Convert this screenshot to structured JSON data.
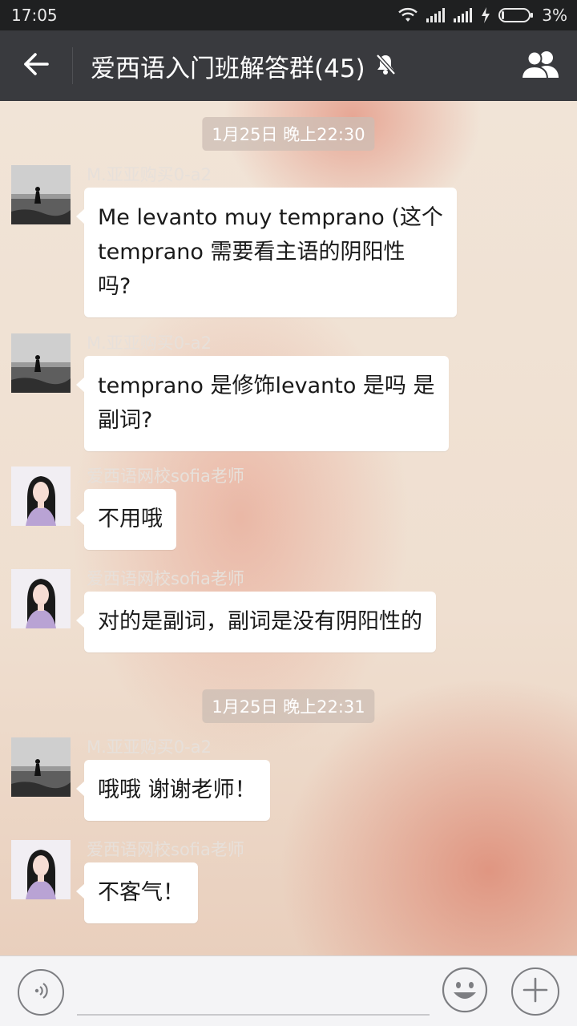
{
  "status_bar": {
    "time": "17:05",
    "battery_percent": "3%",
    "icons": [
      "wifi-icon",
      "signal-icon",
      "signal-icon",
      "charging-icon",
      "battery-icon"
    ]
  },
  "header": {
    "title": "爱西语入门班解答群(45)",
    "icons": [
      "back-arrow-icon",
      "mute-bell-icon",
      "group-members-icon"
    ]
  },
  "timestamps": [
    "1月25日 晚上22:30",
    "1月25日 晚上22:31"
  ],
  "messages": [
    {
      "sender": "M.亚亚购买0-a2",
      "avatar": "beach-avatar",
      "lines": [
        "Me levanto muy temprano (这个",
        "temprano 需要看主语的阴阳性",
        "吗?"
      ]
    },
    {
      "sender": "M.亚亚购买0-a2",
      "avatar": "beach-avatar",
      "lines": [
        "temprano 是修饰levanto 是吗 是",
        "副词?"
      ]
    },
    {
      "sender": "爱西语网校sofia老师",
      "avatar": "woman-avatar",
      "lines": [
        "不用哦"
      ]
    },
    {
      "sender": "爱西语网校sofia老师",
      "avatar": "woman-avatar",
      "lines": [
        "对的是副词，副词是没有阴阳性的"
      ]
    },
    {
      "sender": "M.亚亚购买0-a2",
      "avatar": "beach-avatar",
      "lines": [
        "哦哦 谢谢老师！"
      ]
    },
    {
      "sender": "爱西语网校sofia老师",
      "avatar": "woman-avatar",
      "lines": [
        "不客气！"
      ]
    }
  ],
  "input_bar": {
    "text_value": "",
    "icons": [
      "voice-icon",
      "emoji-icon",
      "plus-icon"
    ]
  },
  "colors": {
    "header_bg": "#393a3e",
    "status_bg": "#1f2021",
    "bubble_bg": "#ffffff",
    "input_bg": "#f4f4f6"
  }
}
